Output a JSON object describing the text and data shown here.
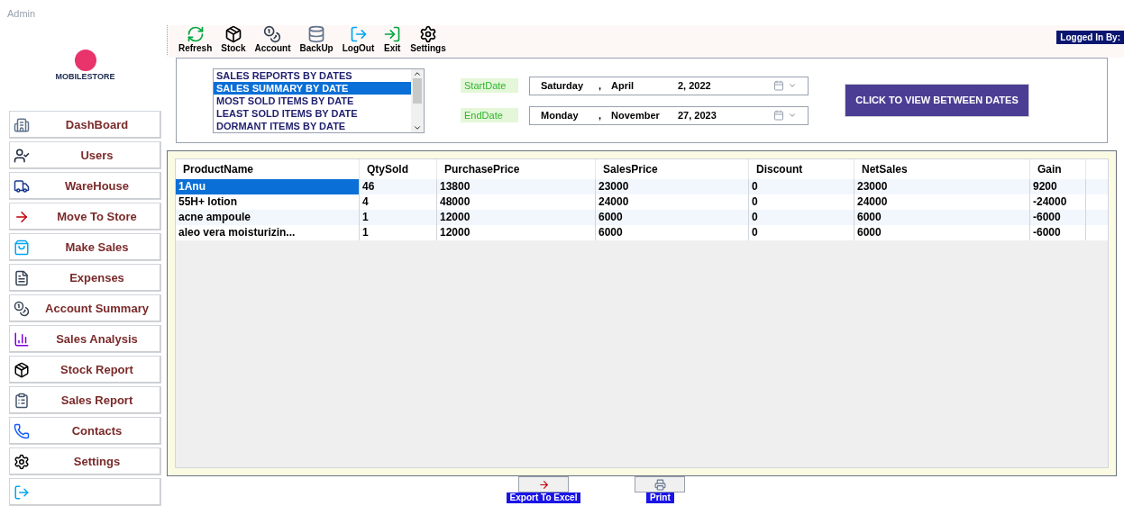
{
  "window": {
    "title": "Admin"
  },
  "logo": {
    "name": "MOBILESTORE"
  },
  "toolbar": [
    {
      "label": "Refresh",
      "kind": "refresh"
    },
    {
      "label": "Stock",
      "kind": "stock"
    },
    {
      "label": "Account",
      "kind": "account"
    },
    {
      "label": "BackUp",
      "kind": "backup"
    },
    {
      "label": "LogOut",
      "kind": "logout"
    },
    {
      "label": "Exit",
      "kind": "exit"
    },
    {
      "label": "Settings",
      "kind": "settings"
    }
  ],
  "logged_in": "Logged In By:",
  "sidebar": {
    "items": [
      {
        "label": "DashBoard",
        "kind": "dashboard"
      },
      {
        "label": "Users",
        "kind": "users"
      },
      {
        "label": "WareHouse",
        "kind": "warehouse"
      },
      {
        "label": "Move To Store",
        "kind": "move"
      },
      {
        "label": "Make Sales",
        "kind": "sales"
      },
      {
        "label": "Expenses",
        "kind": "expenses"
      },
      {
        "label": "Account Summary",
        "kind": "account"
      },
      {
        "label": "Sales Analysis",
        "kind": "analysis"
      },
      {
        "label": "Stock Report",
        "kind": "stock"
      },
      {
        "label": "Sales Report",
        "kind": "report"
      },
      {
        "label": "Contacts",
        "kind": "contacts"
      },
      {
        "label": "Settings",
        "kind": "settings"
      },
      {
        "kind": "logout"
      }
    ]
  },
  "report_list": [
    {
      "label": "SALES REPORTS BY DATES",
      "selected": false
    },
    {
      "label": "SALES SUMMARY BY DATE",
      "selected": true
    },
    {
      "label": "MOST SOLD ITEMS BY DATE",
      "selected": false
    },
    {
      "label": "LEAST SOLD ITEMS BY DATE",
      "selected": false
    },
    {
      "label": "DORMANT ITEMS BY DATE",
      "selected": false
    }
  ],
  "start_date": {
    "label": "StartDate",
    "day": "Saturday",
    "sep": ",",
    "month": "April",
    "date": "2, 2022"
  },
  "end_date": {
    "label": "EndDate",
    "day": "Monday",
    "sep": ",",
    "month": "November",
    "date": "27, 2023"
  },
  "view_button": "CLICK TO VIEW BETWEEN DATES",
  "table": {
    "columns": [
      "ProductName",
      "QtySold",
      "PurchasePrice",
      "SalesPrice",
      "Discount",
      "NetSales",
      "Gain"
    ],
    "rows": [
      {
        "cells": [
          "1Anu",
          "46",
          "13800",
          "23000",
          "0",
          "23000",
          "9200"
        ],
        "selected": true
      },
      {
        "cells": [
          "55H+ lotion",
          "4",
          "48000",
          "24000",
          "0",
          "24000",
          "-24000"
        ],
        "selected": false
      },
      {
        "cells": [
          "acne ampoule",
          "1",
          "12000",
          "6000",
          "0",
          "6000",
          "-6000"
        ],
        "selected": false
      },
      {
        "cells": [
          "aleo vera moisturizin...",
          "1",
          "12000",
          "6000",
          "0",
          "6000",
          "-6000"
        ],
        "selected": false
      }
    ]
  },
  "bottom_buttons": [
    {
      "label": "Export To Excel",
      "kind": "export"
    },
    {
      "label": "Print",
      "kind": "print"
    }
  ]
}
